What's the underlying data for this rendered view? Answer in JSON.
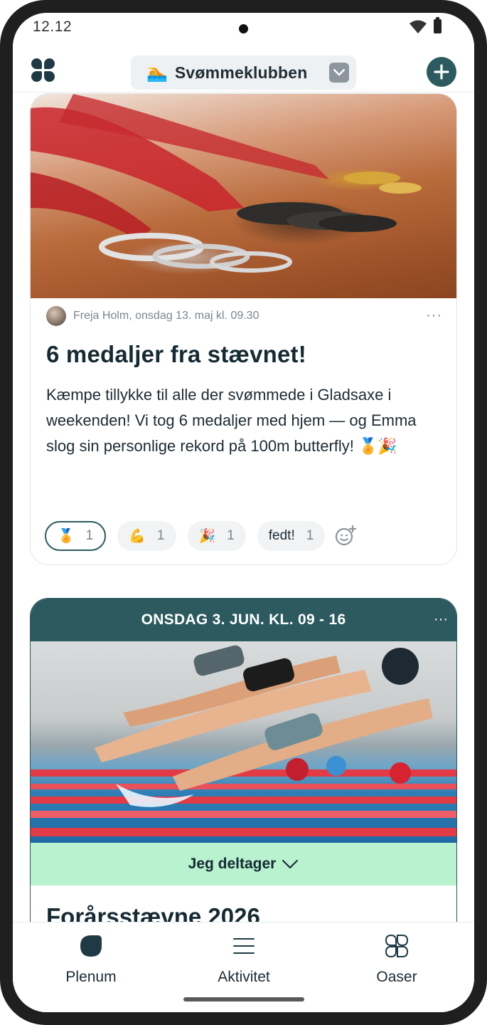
{
  "status": {
    "time": "12.12"
  },
  "header": {
    "club_emoji": "🏊",
    "club_name": "Svømmeklubben"
  },
  "post": {
    "author_line": "Freja Holm, onsdag 13. maj kl. 09.30",
    "more": "···",
    "title": "6 medaljer fra stævnet!",
    "body": "Kæmpe tillykke til alle der svømmede i Gladsaxe i weekenden! Vi tog 6 medaljer med hjem — og Emma slog sin personlige rekord på 100m butterfly! 🏅🎉",
    "reactions": [
      {
        "emoji": "🏅",
        "count": "1",
        "active": true
      },
      {
        "emoji": "💪",
        "count": "1",
        "active": false
      },
      {
        "emoji": "🎉",
        "count": "1",
        "active": false
      },
      {
        "emoji": "fedt!",
        "count": "1",
        "active": false
      }
    ]
  },
  "event": {
    "date": "ONSDAG 3. JUN. KL. 09 - 16",
    "more": "···",
    "rsvp_label": "Jeg deltager",
    "title": "Forårsstævne 2026"
  },
  "nav": {
    "items": [
      {
        "label": "Plenum",
        "icon": "leaf-icon"
      },
      {
        "label": "Aktivitet",
        "icon": "activity-lines-icon"
      },
      {
        "label": "Oaser",
        "icon": "oasis-grid-icon"
      }
    ]
  },
  "colors": {
    "brand_teal": "#2c5a5e",
    "rsvp_green": "#b8f2cf",
    "text_dark": "#152a33",
    "muted": "#7b858b"
  }
}
